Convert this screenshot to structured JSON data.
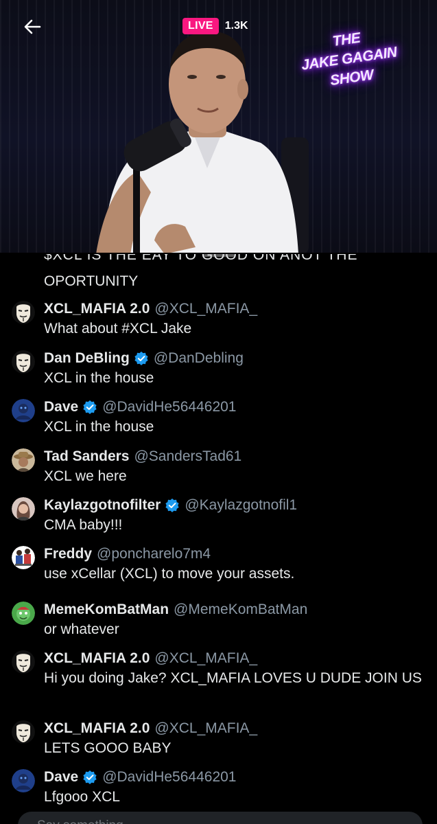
{
  "header": {
    "back_icon": "back-arrow-icon",
    "live_label": "LIVE",
    "viewer_count": "1.3K",
    "show_sign": [
      "THE",
      "JAKE GAGAIN",
      "SHOW"
    ]
  },
  "chat": {
    "cut_off_text": "$XCL IS THE EAY TO GOOD ON ANOT THE",
    "previous_line": "OPORTUNITY",
    "messages": [
      {
        "name": "XCL_MAFIA 2.0",
        "verified": false,
        "handle": "@XCL_MAFIA_",
        "text": "What about #XCL Jake",
        "avatar": "anon-mask"
      },
      {
        "name": "Dan DeBling",
        "verified": true,
        "handle": "@DanDebling",
        "text": "XCL in the house",
        "avatar": "anon-mask"
      },
      {
        "name": "Dave",
        "verified": true,
        "handle": "@DavidHe56446201",
        "text": "XCL in the house",
        "avatar": "blue"
      },
      {
        "name": "Tad Sanders",
        "verified": false,
        "handle": "@SandersTad61",
        "text": "XCL we here",
        "avatar": "hat"
      },
      {
        "name": "Kaylazgotnofilter",
        "verified": true,
        "handle": "@Kaylazgotnofil1",
        "text": "CMA baby!!!",
        "avatar": "woman"
      },
      {
        "name": "Freddy",
        "verified": false,
        "handle": "@poncharelo7m4",
        "text": "use xCellar (XCL) to move your assets.",
        "avatar": "freddy"
      },
      {
        "name": "MemeKomBatMan",
        "verified": false,
        "handle": "@MemeKomBatMan",
        "text": "or whatever",
        "avatar": "green"
      },
      {
        "name": "XCL_MAFIA 2.0",
        "verified": false,
        "handle": "@XCL_MAFIA_",
        "text": "Hi you doing Jake? XCL_MAFIA LOVES U DUDE JOIN US",
        "avatar": "anon-mask"
      },
      {
        "name": "XCL_MAFIA 2.0",
        "verified": false,
        "handle": "@XCL_MAFIA_",
        "text": "LETS GOOO BABY",
        "avatar": "anon-mask"
      },
      {
        "name": "Dave",
        "verified": true,
        "handle": "@DavidHe56446201",
        "text": "Lfgooo XCL",
        "avatar": "blue"
      }
    ]
  },
  "composer": {
    "placeholder": "Say something..."
  },
  "colors": {
    "live": "#f91880",
    "verified": "#1d9bf0",
    "handle": "#8b98a5",
    "background": "#000000"
  }
}
